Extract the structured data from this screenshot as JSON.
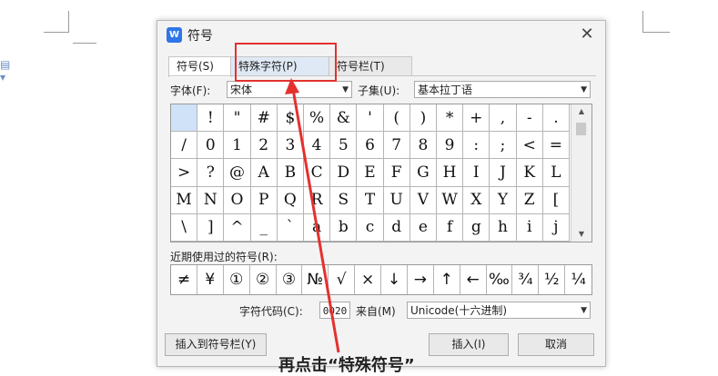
{
  "dialog": {
    "title": "符号",
    "app_icon_letter": "W",
    "close_symbol": "✕"
  },
  "tabs": [
    {
      "label": "符号(S)",
      "active": true
    },
    {
      "label": "特殊字符(P)",
      "active": false
    },
    {
      "label": "符号栏(T)",
      "active": false
    }
  ],
  "font": {
    "label": "字体(F):",
    "value": "宋体"
  },
  "subset": {
    "label": "子集(U):",
    "value": "基本拉丁语"
  },
  "symbol_grid": [
    [
      " ",
      "!",
      "\"",
      "#",
      "$",
      "%",
      "&",
      "'",
      "(",
      ")",
      "*",
      "+",
      ",",
      "-",
      "."
    ],
    [
      "/",
      "0",
      "1",
      "2",
      "3",
      "4",
      "5",
      "6",
      "7",
      "8",
      "9",
      ":",
      ";",
      "<",
      "="
    ],
    [
      ">",
      "?",
      "@",
      "A",
      "B",
      "C",
      "D",
      "E",
      "F",
      "G",
      "H",
      "I",
      "J",
      "K",
      "L"
    ],
    [
      "M",
      "N",
      "O",
      "P",
      "Q",
      "R",
      "S",
      "T",
      "U",
      "V",
      "W",
      "X",
      "Y",
      "Z",
      "["
    ],
    [
      "\\",
      "]",
      "^",
      "_",
      "`",
      "a",
      "b",
      "c",
      "d",
      "e",
      "f",
      "g",
      "h",
      "i",
      "j"
    ]
  ],
  "recent": {
    "label": "近期使用过的符号(R):",
    "symbols": [
      "≠",
      "¥",
      "①",
      "②",
      "③",
      "№",
      "√",
      "×",
      "↓",
      "→",
      "↑",
      "←",
      "‰",
      "¾",
      "½",
      "¼"
    ]
  },
  "char_code": {
    "label": "字符代码(C):",
    "value": "0020"
  },
  "from": {
    "label": "来自(M)",
    "value": "Unicode(十六进制)"
  },
  "buttons": {
    "insert_to_bar": "插入到符号栏(Y)",
    "insert": "插入(I)",
    "cancel": "取消"
  },
  "caption": "再点击“特殊符号”",
  "colors": {
    "highlight": "#e3312f",
    "selected_cell": "#cfe2f8",
    "brand": "#2f76e6"
  }
}
